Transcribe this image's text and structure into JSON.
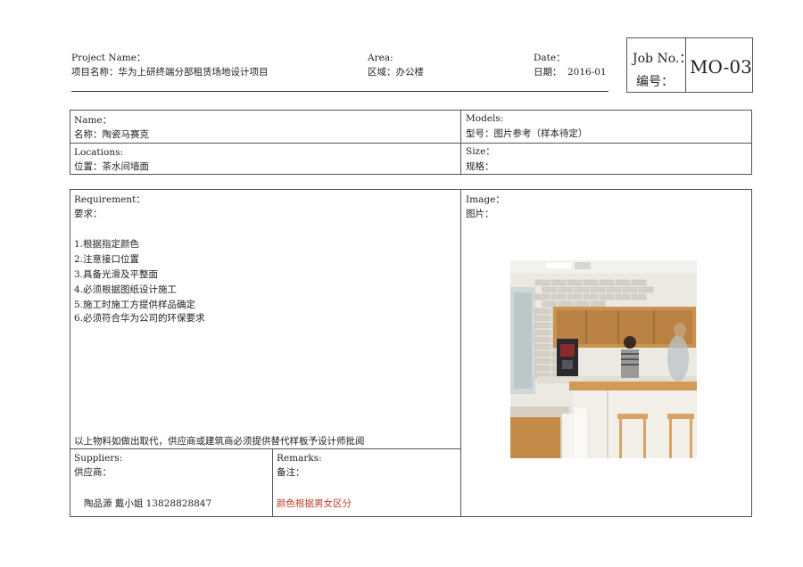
{
  "header": {
    "project_label_en": "Project Name：",
    "project_label_zh": "项目名称：华为上研终端分部租赁场地设计项目",
    "area_label_en": "Area:",
    "area_label_zh": "区域：办公楼",
    "date_label_en": "Date：",
    "date_label_zh": "日期：",
    "date_value": "2016-01",
    "job_label_en": "Job No.：",
    "job_label_zh": "编号：",
    "job_value": "MO-03"
  },
  "info": {
    "name_en": "Name：",
    "name_zh": "名称：陶瓷马赛克",
    "models_en": "Models:",
    "models_zh": "型号：图片参考（样本待定）",
    "locations_en": "Locations:",
    "locations_zh": "位置：茶水间墙面",
    "size_en": "Size：",
    "size_zh": "规格："
  },
  "requirement": {
    "title_en": "Requirement：",
    "title_zh": "要求：",
    "items": [
      "1.根据指定颜色",
      "2.注意接口位置",
      "3.具备光滑及平整面",
      "4.必须根据图纸设计施工",
      "5.施工时施工方提供样品确定",
      "6.必须符合华为公司的环保要求"
    ],
    "footnote": "以上物料如做出取代，供应商或建筑商必须提供替代样板予设计师批阅"
  },
  "image": {
    "title_en": "Image：",
    "title_zh": "图片："
  },
  "suppliers": {
    "title_en": "Suppliers:",
    "title_zh": "供应商：",
    "value": "陶品源 戴小姐 13828828847"
  },
  "remarks": {
    "title_en": "Remarks:",
    "title_zh": "备注：",
    "value": "颜色根据男女区分"
  },
  "colors": {
    "remark_text": "#c0392b",
    "wood": "#c8934f",
    "tile": "#d9d6cf"
  }
}
